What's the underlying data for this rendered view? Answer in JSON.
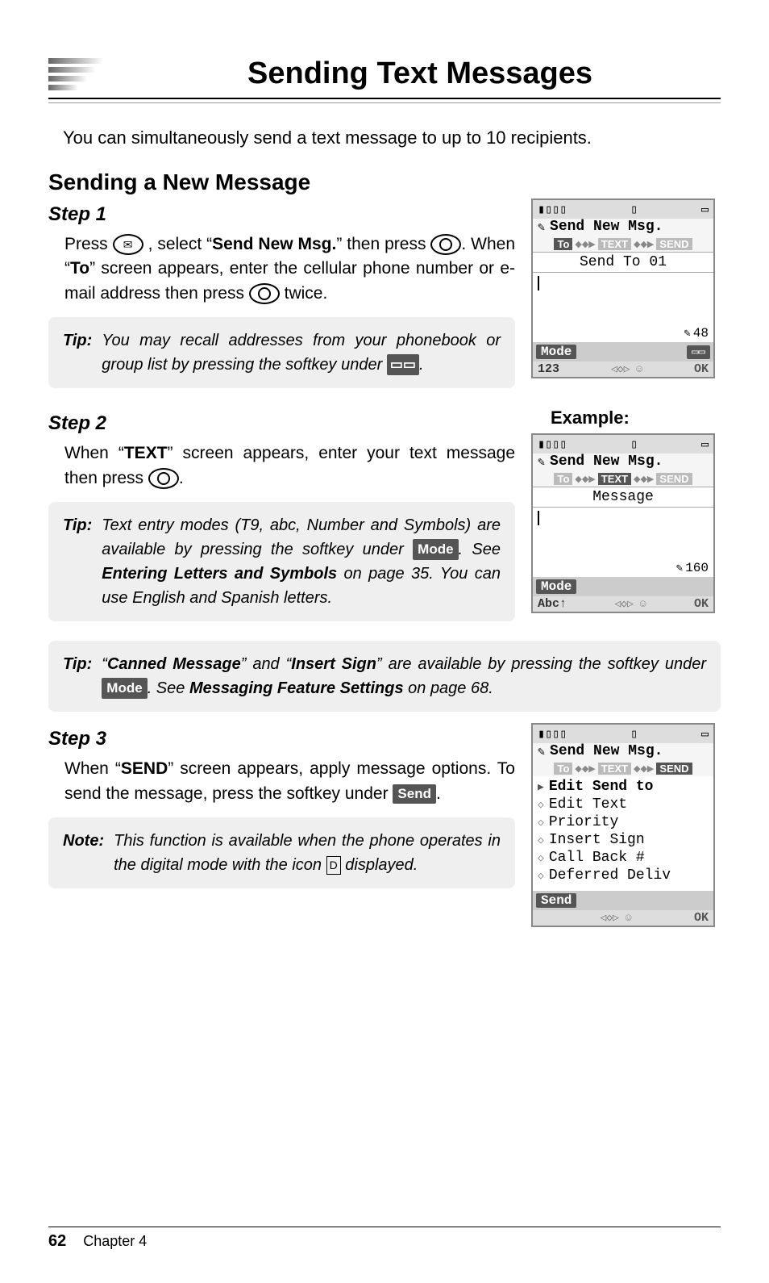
{
  "header": {
    "title": "Sending Text Messages"
  },
  "intro": "You can simultaneously send a text message to up to 10 recipients.",
  "section": "Sending a New Message",
  "step1": {
    "label": "Step 1",
    "press": "Press ",
    "select_pre": ", select “",
    "send_new": "Send New Msg.",
    "select_post": "” then press ",
    "when_pre": ". When “",
    "to_word": "To",
    "when_post": "” screen appears, enter the cellular phone number or e-mail address then press ",
    "twice": " twice.",
    "tip_label": "Tip:",
    "tip_body_a": "You may recall addresses from your phonebook or group list by pressing the softkey under ",
    "tip_body_b": "."
  },
  "step2": {
    "label": "Step 2",
    "body_pre": "When “",
    "text_word": "TEXT",
    "body_mid": "” screen appears, enter your text message then press ",
    "body_post": ".",
    "tipA_label": "Tip:",
    "tipA_a": "Text entry modes (T9, abc, Number and Symbols) are available by pressing the softkey under ",
    "tipA_b": ". See ",
    "tipA_ref": "Entering Letters and Symbols",
    "tipA_c": " on page 35. You can use English and Spanish letters.",
    "tipB_label": "Tip:",
    "tipB_a": "“",
    "tipB_canned": "Canned Message",
    "tipB_b": "” and “",
    "tipB_insert": "Insert Sign",
    "tipB_c": "” are available by pressing the softkey under ",
    "tipB_d": ". See ",
    "tipB_ref": "Messaging Feature Settings",
    "tipB_e": " on page 68.",
    "example_label": "Example:"
  },
  "step3": {
    "label": "Step 3",
    "body_pre": "When “",
    "send_word": "SEND",
    "body_mid": "” screen appears, apply message options. To send the message, press the softkey under ",
    "body_post": ".",
    "note_label": "Note:",
    "note_a": "This function is available when the phone operates in the digital mode with the icon ",
    "note_b": " displayed."
  },
  "chips": {
    "mode": "Mode",
    "send": "Send",
    "book": "██",
    "digital": "D"
  },
  "screen1": {
    "title": "Send New Msg.",
    "tabs": [
      "To",
      "TEXT",
      "SEND"
    ],
    "active_tab": 0,
    "sub": "Send To 01",
    "count": "48",
    "soft_left": "Mode",
    "bottom_left": "123",
    "bottom_ok": "OK"
  },
  "screen2": {
    "title": "Send New Msg.",
    "tabs": [
      "To",
      "TEXT",
      "SEND"
    ],
    "active_tab": 1,
    "sub": "Message",
    "count": "160",
    "soft_left": "Mode",
    "bottom_left": "Abc↑",
    "bottom_ok": "OK"
  },
  "screen3": {
    "title": "Send New Msg.",
    "tabs": [
      "To",
      "TEXT",
      "SEND"
    ],
    "active_tab": 2,
    "items": [
      "Edit Send to",
      "Edit Text",
      "Priority",
      "Insert Sign",
      "Call Back #",
      "Deferred Deliv"
    ],
    "selected": 0,
    "soft_left": "Send",
    "bottom_ok": "OK"
  },
  "footer": {
    "page": "62",
    "chapter": "Chapter 4"
  }
}
